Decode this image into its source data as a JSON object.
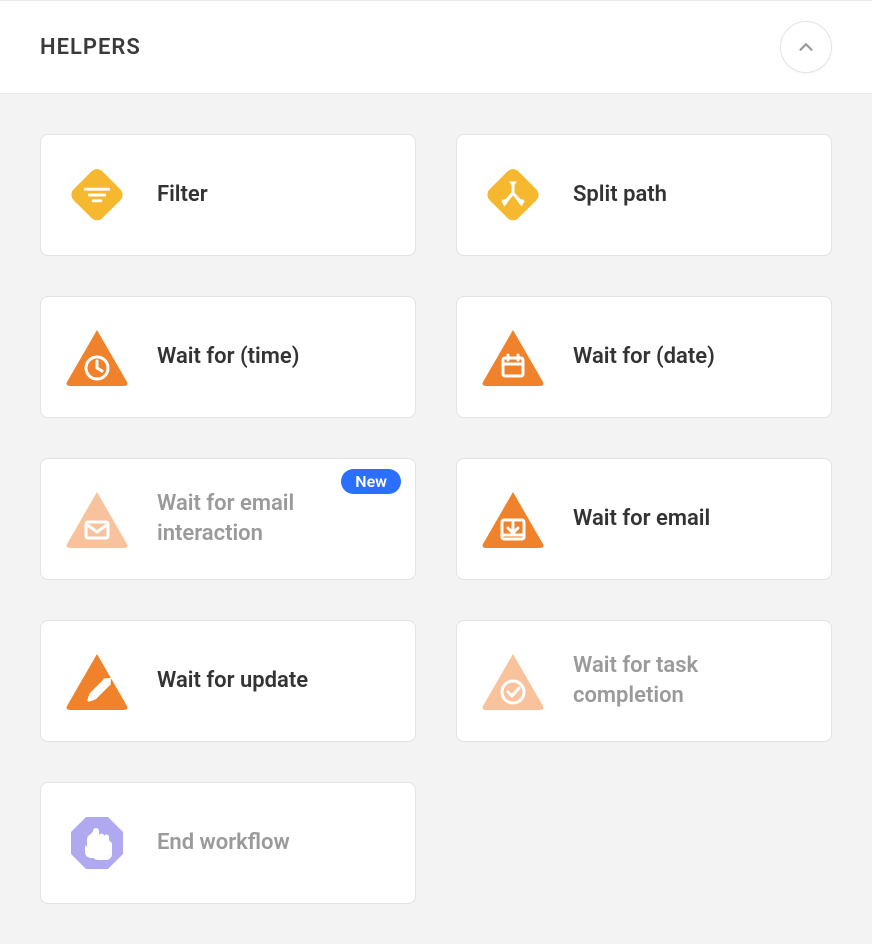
{
  "section": {
    "title": "HELPERS"
  },
  "badges": {
    "new": "New"
  },
  "cards": {
    "filter": "Filter",
    "split_path": "Split path",
    "wait_for_time": "Wait for (time)",
    "wait_for_date": "Wait for (date)",
    "wait_for_email_interaction": "Wait for email interaction",
    "wait_for_email": "Wait for email",
    "wait_for_update": "Wait for update",
    "wait_for_task_completion": "Wait for task completion",
    "end_workflow": "End workflow"
  },
  "colors": {
    "yellow": "#f5b82e",
    "orange": "#f0822b",
    "orange_muted": "#f8c39c",
    "purple_muted": "#b0a9f0",
    "blue_badge": "#2b6fff"
  }
}
